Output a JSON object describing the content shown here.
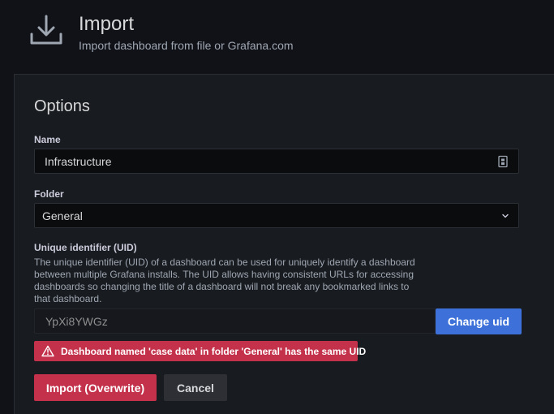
{
  "header": {
    "icon": "import-icon",
    "title": "Import",
    "subtitle": "Import dashboard from file or Grafana.com"
  },
  "options": {
    "title": "Options",
    "name_label": "Name",
    "name_value": "Infrastructure",
    "name_icon": "clipboard-icon",
    "folder_label": "Folder",
    "folder_value": "General",
    "folder_icon": "chevron-down-icon",
    "uid_label": "Unique identifier (UID)",
    "uid_description": "The unique identifier (UID) of a dashboard can be used for uniquely identify a dashboard between multiple Grafana installs. The UID allows having consistent URLs for accessing dashboards so changing the title of a dashboard will not break any bookmarked links to that dashboard.",
    "uid_value": "YpXi8YWGz",
    "change_uid_label": "Change uid",
    "error_icon": "warning-icon",
    "error_text": "Dashboard named 'case data' in folder 'General' has the same UID",
    "import_button": "Import (Overwrite)",
    "cancel_button": "Cancel"
  },
  "colors": {
    "background": "#111217",
    "panel": "#181b1f",
    "primary": "#3d71d9",
    "danger": "#c4314b"
  }
}
